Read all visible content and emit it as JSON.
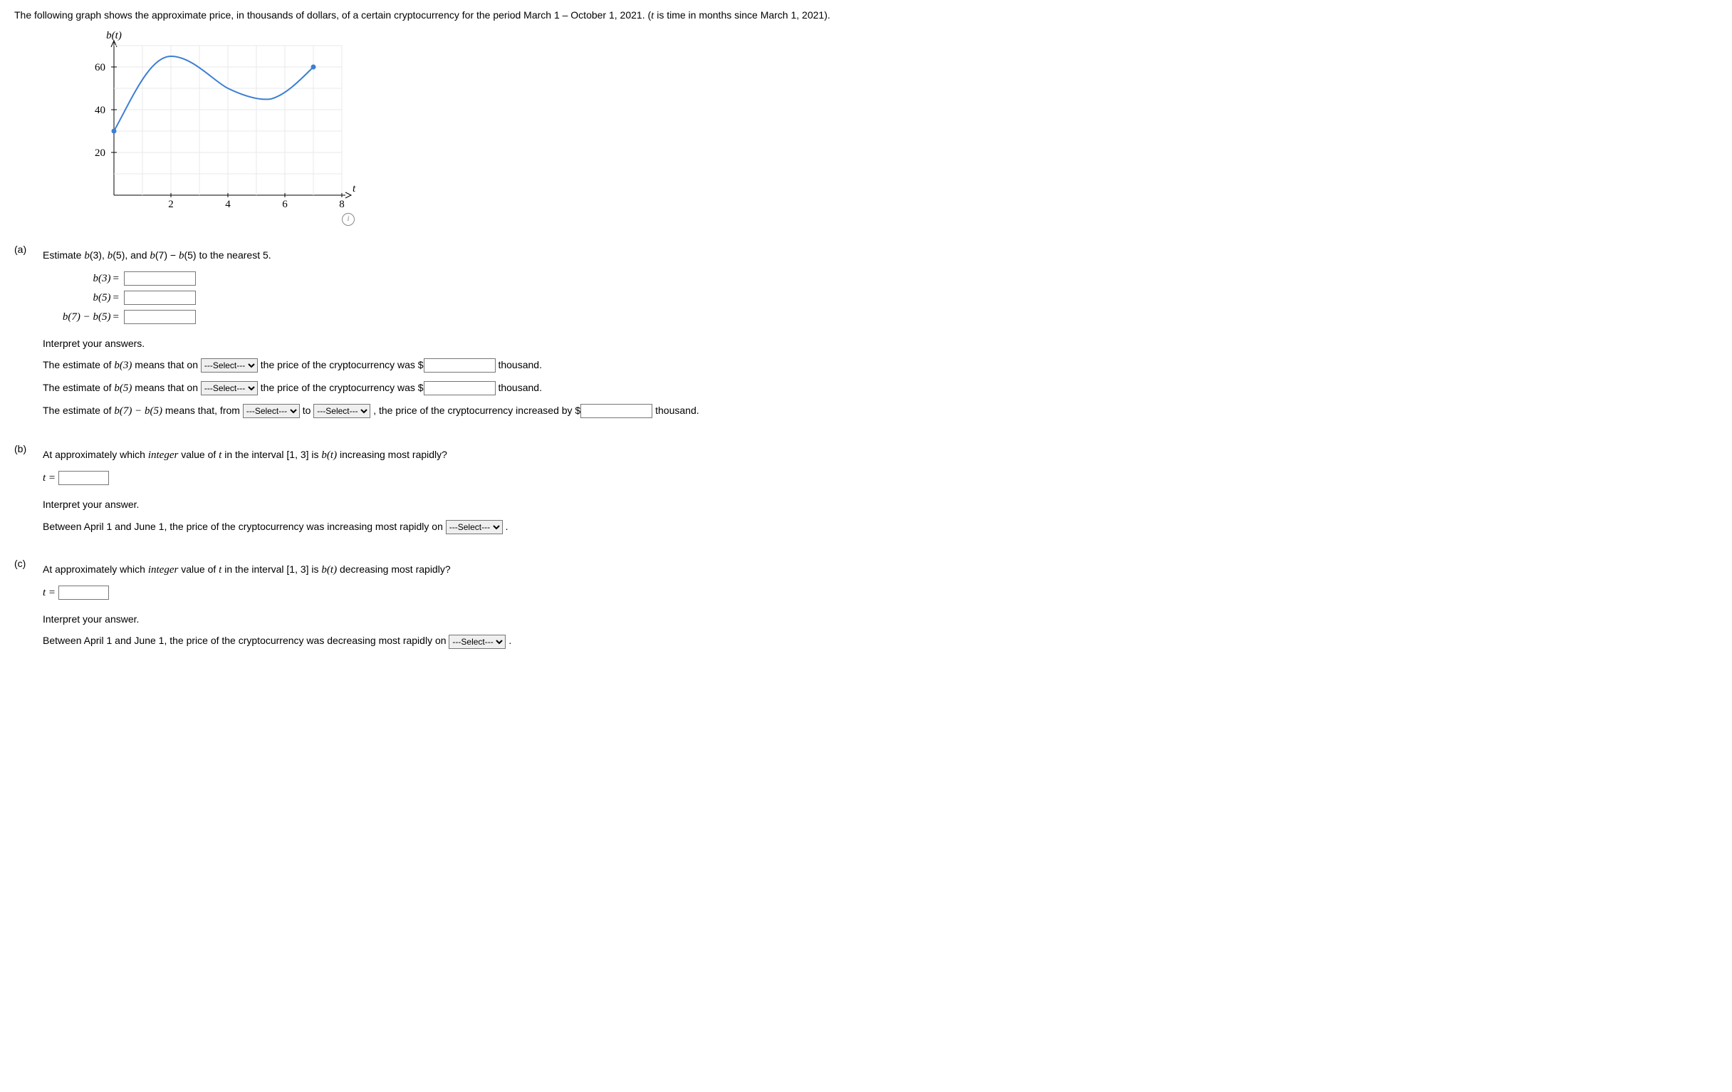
{
  "intro": "The following graph shows the approximate price, in thousands of dollars, of a certain cryptocurrency for the period March 1 – October 1, 2021. (",
  "intro_var": "t",
  "intro_tail": " is time in months since March 1, 2021).",
  "chart_data": {
    "type": "line",
    "ylabel": "b(t)",
    "xlabel": "t",
    "x": [
      0,
      1,
      2,
      3,
      4,
      5,
      6,
      7
    ],
    "y": [
      30,
      50,
      65,
      60,
      50,
      45,
      50,
      60
    ],
    "x_ticks": [
      2,
      4,
      6,
      8
    ],
    "y_ticks": [
      20,
      40,
      60
    ],
    "xlim": [
      0,
      8
    ],
    "ylim": [
      0,
      70
    ],
    "endpoint_markers": true
  },
  "a": {
    "label": "(a)",
    "prompt": "Estimate b(3), b(5), and b(7) − b(5) to the nearest 5.",
    "rows": [
      {
        "lhs_math": "b(3)",
        "eq": "="
      },
      {
        "lhs_math": "b(5)",
        "eq": "="
      },
      {
        "lhs_math": "b(7) − b(5)",
        "eq": "="
      }
    ],
    "interpret_head": "Interpret your answers.",
    "line1_a": "The estimate of ",
    "line1_b": " means that on ",
    "select_placeholder": "---Select---",
    "line1_c": " the price of the cryptocurrency was $",
    "line1_d": " thousand.",
    "line3_a": "The estimate of ",
    "line3_b": " means that, from ",
    "to": " to ",
    "line3_c": " , the price of the cryptocurrency increased by $",
    "b3": "b(3)",
    "b5": "b(5)",
    "bdiff": "b(7) − b(5)"
  },
  "b": {
    "label": "(b)",
    "prompt_a": "At approximately which ",
    "integer_word": "integer",
    "prompt_b": " value of ",
    "t_var": "t",
    "prompt_c": " in the interval [1, 3] is ",
    "bt": "b(t)",
    "prompt_d": " increasing most rapidly?",
    "t_eq": "t =",
    "interpret_head": "Interpret your answer.",
    "sentence": "Between April 1 and June 1, the price of the cryptocurrency was increasing most rapidly on ",
    "period": " ."
  },
  "c": {
    "label": "(c)",
    "prompt_d": " decreasing most rapidly?",
    "sentence": "Between April 1 and June 1, the price of the cryptocurrency was decreasing most rapidly on "
  }
}
